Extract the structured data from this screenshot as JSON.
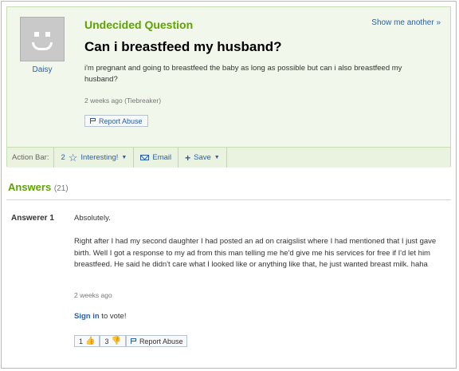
{
  "question": {
    "status": "Undecided Question",
    "show_another": "Show me another »",
    "title": "Can i breastfeed my husband?",
    "body": "i'm pregnant and going to breastfeed the baby as long as possible but can i also breastfeed my husband?",
    "meta": "2 weeks ago (Tiebreaker)",
    "report_label": "Report Abuse",
    "asker": "Daisy"
  },
  "action_bar": {
    "label": "Action Bar:",
    "interesting_count": "2",
    "interesting_label": "Interesting!",
    "email_label": "Email",
    "save_label": "Save"
  },
  "answers": {
    "heading": "Answers",
    "count": "(21)",
    "items": [
      {
        "answerer": "Answerer 1",
        "first_line": "Absolutely.",
        "body": "Right after I had my second daughter I had posted an ad on craigslist where I had mentioned that I just gave birth.  Well I got a response to my ad from this man telling me he'd give me his services for free if I'd let him breastfeed.  He said he didn't care what I looked like or anything like that, he just wanted breast milk. haha",
        "meta": "2 weeks ago",
        "signin_link": "Sign in",
        "signin_text": " to vote!",
        "thumbs_up": "1",
        "thumbs_down": "3",
        "report_label": "Report Abuse"
      }
    ]
  },
  "colors": {
    "accent_green": "#5fa300",
    "link_blue": "#2a5fa8",
    "question_bg": "#f1f7ea"
  },
  "icons": [
    "avatar-icon",
    "flag-icon",
    "star-icon",
    "mail-icon",
    "plus-icon",
    "thumbs-up-icon",
    "thumbs-down-icon"
  ]
}
